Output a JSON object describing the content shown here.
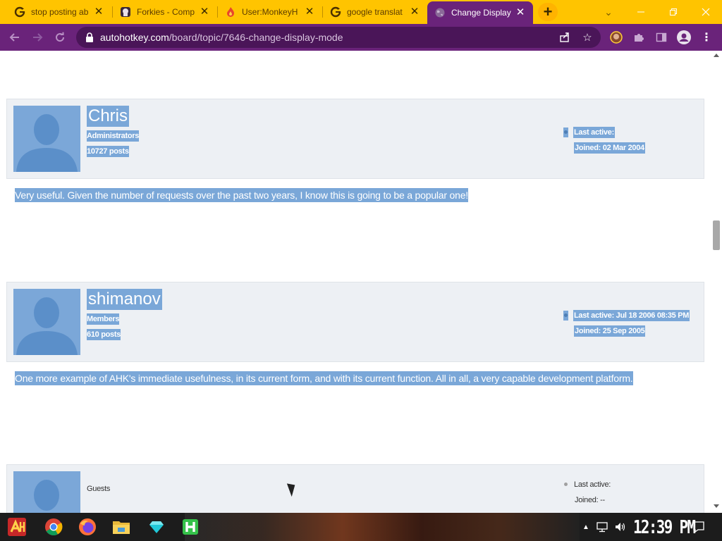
{
  "browser": {
    "tabs": [
      {
        "title": "stop posting ab",
        "icon": "google-icon",
        "active": false
      },
      {
        "title": "Forkies - Comp",
        "icon": "forkies-icon",
        "active": false
      },
      {
        "title": "User:MonkeyH",
        "icon": "flame-icon",
        "active": false
      },
      {
        "title": "google translat",
        "icon": "google-icon",
        "active": false
      },
      {
        "title": "Change Display",
        "icon": "globe-icon",
        "active": true
      }
    ],
    "new_tab_label": "+",
    "url_host": "autohotkey.com",
    "url_path": "/board/topic/7646-change-display-mode",
    "colors": {
      "tabstrip": "#ffc400",
      "toolbar": "#6a237a",
      "highlight": "#7aa7d8"
    }
  },
  "posts": [
    {
      "username": "Chris",
      "group": "Administrators",
      "post_count": "10727 posts",
      "last_active": "Last active:",
      "joined": "Joined: 02 Mar 2004",
      "body": "Very useful. Given the number of requests over the past two years, I know this is going to be a popular one!",
      "highlighted": true
    },
    {
      "username": "shimanov",
      "group": "Members",
      "post_count": "610 posts",
      "last_active": "Last active: Jul 18 2006 08:35 PM",
      "joined": "Joined: 25 Sep 2005",
      "body": "One more example of AHK's immediate usefulness, in its current form, and with its current function. All in all, a very capable development platform.",
      "highlighted": true
    },
    {
      "username": "",
      "group": "Guests",
      "post_count": "",
      "last_active": "Last active:",
      "joined": "Joined: --",
      "body": "",
      "highlighted": false
    }
  ],
  "taskbar": {
    "apps": [
      "ahk-icon",
      "chrome-icon",
      "firefox-icon",
      "file-explorer-icon",
      "gem-icon",
      "h-app-icon"
    ],
    "clock": "12:39 PM"
  }
}
